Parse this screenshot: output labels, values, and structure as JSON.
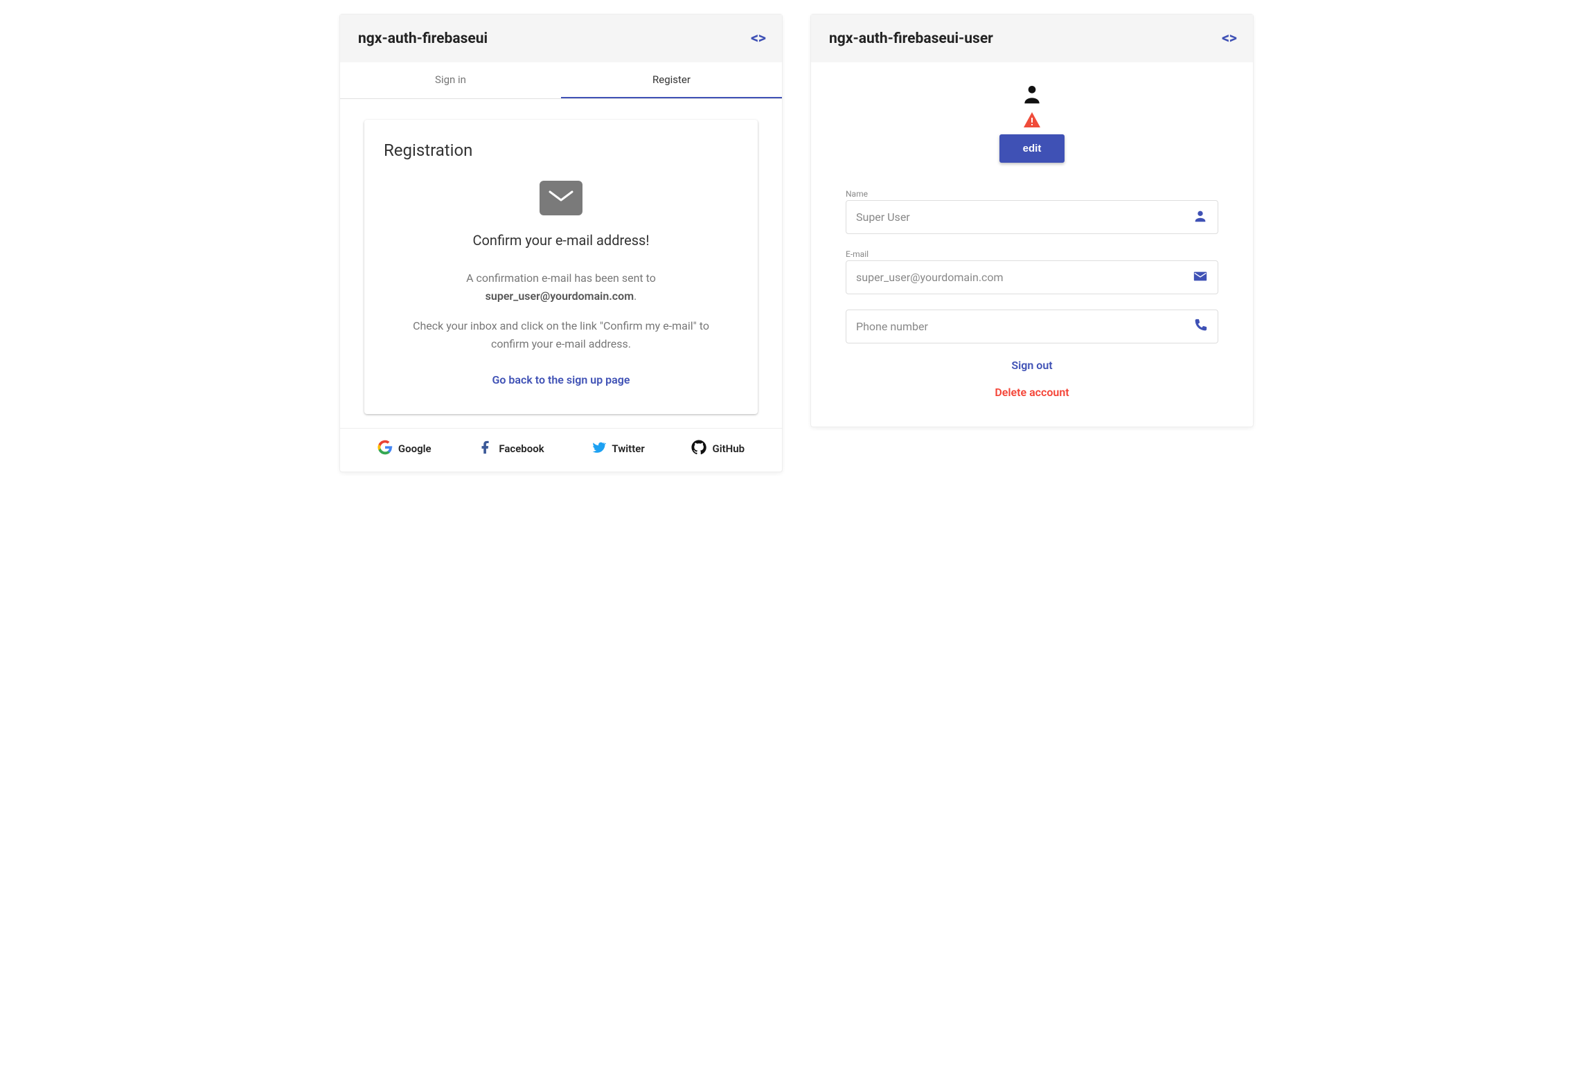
{
  "left": {
    "title": "ngx-auth-firebaseui",
    "tabs": {
      "signin": "Sign in",
      "register": "Register"
    },
    "registration": {
      "heading": "Registration",
      "confirm_title": "Confirm your e-mail address!",
      "sent_prefix": "A confirmation e-mail has been sent to",
      "email": "super_user@yourdomain.com",
      "instructions": "Check your inbox and click on the link \"Confirm my e-mail\" to confirm your e-mail address.",
      "back_link": "Go back to the sign up page"
    },
    "social": {
      "google": "Google",
      "facebook": "Facebook",
      "twitter": "Twitter",
      "github": "GitHub"
    }
  },
  "right": {
    "title": "ngx-auth-firebaseui-user",
    "edit_label": "edit",
    "fields": {
      "name_label": "Name",
      "name_value": "Super User",
      "email_label": "E-mail",
      "email_value": "super_user@yourdomain.com",
      "phone_placeholder": "Phone number"
    },
    "signout": "Sign out",
    "delete": "Delete account"
  }
}
